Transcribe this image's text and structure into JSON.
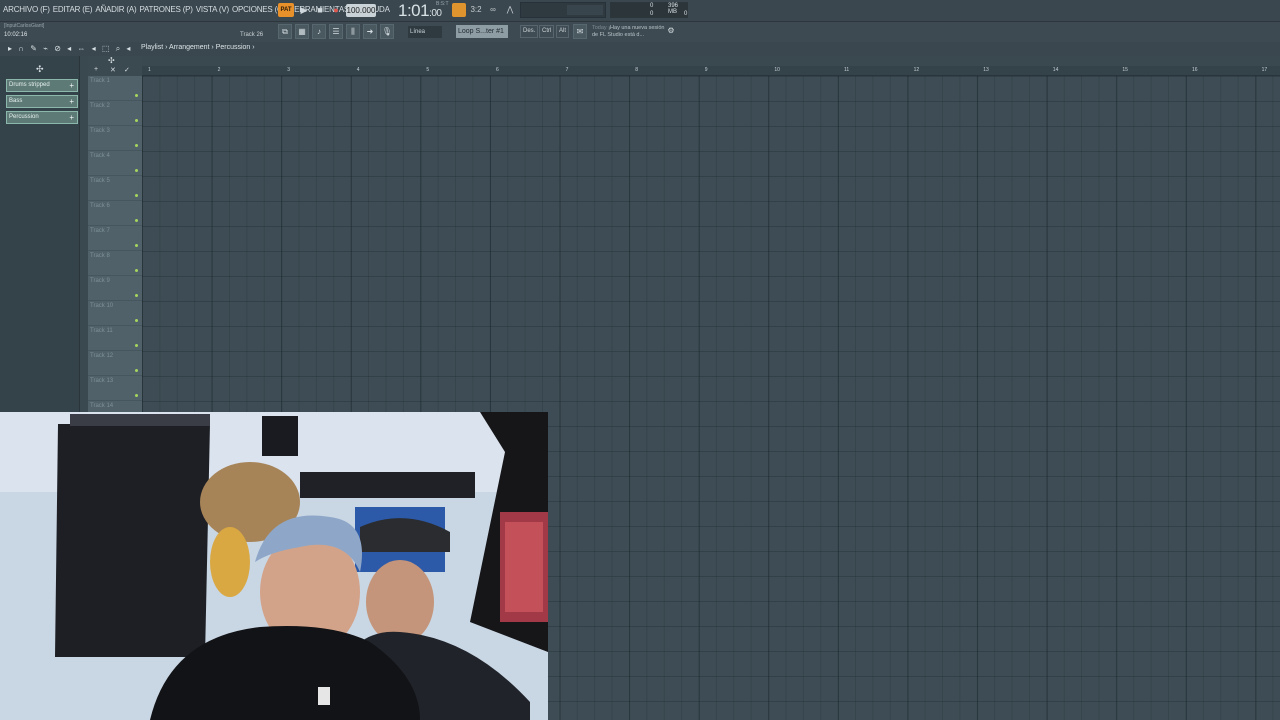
{
  "menu": {
    "items": [
      "ARCHIVO (F)",
      "EDITAR (E)",
      "AÑADIR (A)",
      "PATRONES (P)",
      "VISTA (V)",
      "OPCIONES (O)",
      "HERRAMIENTAS (T)",
      "AYUDA"
    ]
  },
  "transport": {
    "pattern_label": "PAT",
    "tempo": "100.000",
    "time_main": "1:01",
    "time_sub": ":00",
    "bst": "B:S:T"
  },
  "performance": {
    "cpu_a": "0",
    "memory": "396 MB",
    "cpu_b": "0",
    "poly": "0"
  },
  "status": {
    "hint": "[InputCarlosGiant]",
    "clock": "10:02:16",
    "track": "Track 26"
  },
  "snap": {
    "value": "Línea"
  },
  "pattern": {
    "selected": "Loop S...ter #1"
  },
  "buttons": {
    "des": "Des.",
    "ctrl": "Ctrl",
    "alt": "Alt"
  },
  "news": {
    "label": "Today",
    "text": "¡Hay una nueva sesión de FL Studio está d..."
  },
  "playlist": {
    "breadcrumb": "Playlist › Arrangement › Percussion ›"
  },
  "patterns": [
    {
      "label": "Drums stripped"
    },
    {
      "label": "Bass"
    },
    {
      "label": "Percussion"
    }
  ],
  "tracks": [
    "Track 1",
    "Track 2",
    "Track 3",
    "Track 4",
    "Track 5",
    "Track 6",
    "Track 7",
    "Track 8",
    "Track 9",
    "Track 10",
    "Track 11",
    "Track 12",
    "Track 13",
    "Track 14"
  ],
  "ruler": [
    "1",
    "2",
    "3",
    "4",
    "5",
    "6",
    "7",
    "8",
    "9",
    "10",
    "11",
    "12",
    "13",
    "14",
    "15",
    "16",
    "17"
  ],
  "colors": {
    "accent_orange": "#e8902a",
    "pattern_green": "#5d7a76",
    "grid_bg": "#3e4d55"
  }
}
